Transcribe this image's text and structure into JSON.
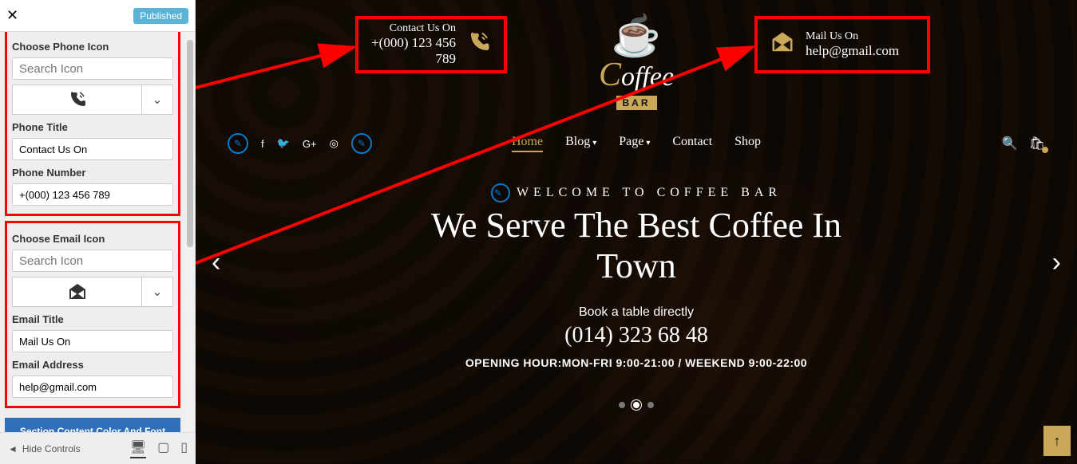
{
  "status_badge": "Published",
  "sidebar": {
    "phone_icon_label": "Choose Phone Icon",
    "search_placeholder": "Search Icon",
    "phone_title_label": "Phone Title",
    "phone_title_value": "Contact Us On",
    "phone_number_label": "Phone Number",
    "phone_number_value": "+(000) 123 456 789",
    "email_icon_label": "Choose Email Icon",
    "email_title_label": "Email Title",
    "email_title_value": "Mail Us On",
    "email_address_label": "Email Address",
    "email_address_value": "help@gmail.com",
    "section_button": "Section Content Color And Font Settings",
    "hide_controls": "Hide Controls"
  },
  "preview": {
    "contact_phone_title": "Contact Us On",
    "contact_phone_value": "+(000) 123 456 789",
    "contact_mail_title": "Mail Us On",
    "contact_mail_value": "help@gmail.com",
    "logo_main": "Coffee",
    "logo_sub": "BAR",
    "nav": {
      "home": "Home",
      "blog": "Blog",
      "page": "Page",
      "contact": "Contact",
      "shop": "Shop"
    },
    "hero_eyebrow": "WELCOME TO COFFEE BAR",
    "hero_title1": "We Serve The Best Coffee In",
    "hero_title2": "Town",
    "hero_sub": "Book a table directly",
    "hero_phone": "(014) 323 68 48",
    "hero_hours": "OPENING HOUR:MON-FRI 9:00-21:00 / WEEKEND 9:00-22:00"
  }
}
